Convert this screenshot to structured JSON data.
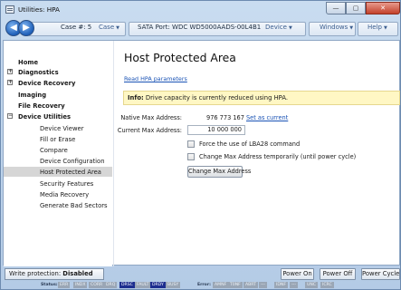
{
  "window": {
    "title": "Utilities: HPA",
    "min_label": "—",
    "max_label": "▢",
    "close_label": "✕"
  },
  "nav": {
    "back": "◀",
    "forward": "▶",
    "case_label": "Case #: 5",
    "case_menu": "Case",
    "port_label": "SATA Port: WDC WD5000AADS-00L4B1",
    "device_menu": "Device",
    "windows_menu": "Windows",
    "help_menu": "Help",
    "caret": "▼"
  },
  "sidebar": {
    "items": [
      {
        "label": "Home"
      },
      {
        "label": "Diagnostics",
        "expander": "+"
      },
      {
        "label": "Device Recovery",
        "expander": "+"
      },
      {
        "label": "Imaging"
      },
      {
        "label": "File Recovery"
      },
      {
        "label": "Device Utilities",
        "expander": "−"
      },
      {
        "label": "Device Viewer"
      },
      {
        "label": "Fill or Erase"
      },
      {
        "label": "Compare"
      },
      {
        "label": "Device Configuration"
      },
      {
        "label": "Host Protected Area"
      },
      {
        "label": "Security Features"
      },
      {
        "label": "Media Recovery"
      },
      {
        "label": "Generate Bad Sectors"
      }
    ]
  },
  "content": {
    "title": "Host Protected Area",
    "read_link": "Read HPA parameters",
    "info_prefix": "Info:",
    "info_text": "Drive capacity is currently reduced using HPA.",
    "native_label": "Native Max Address:",
    "native_value": "976 773 167",
    "set_current": "Set as current",
    "current_label": "Current Max Address:",
    "current_value": "10 000 000",
    "opt1": "Force the use of LBA28 command",
    "opt2": "Change Max Address temporarily (until power cycle)",
    "change_button": "Change Max Address"
  },
  "bottom": {
    "wp_label": "Write protection:",
    "wp_value": "Disabled",
    "power_on": "Power On",
    "power_off": "Power Off",
    "power_cycle": "Power Cycle",
    "status_label": "Status:",
    "status_regs": [
      "ERR",
      "INDX",
      "CORR",
      "DRQ",
      "DRSC",
      "FAULT",
      "DRDY",
      "BUSY"
    ],
    "error_label": "Error:",
    "error_regs": [
      "AMNF",
      "T0NF",
      "ABRT",
      "---",
      "IDNF",
      "---",
      "UNC",
      "ICRC"
    ],
    "active_regs": [
      "DRSC",
      "DRDY"
    ],
    "colors": {
      "active": "#1d2e8f",
      "inactive": "#9aa6b5"
    }
  }
}
